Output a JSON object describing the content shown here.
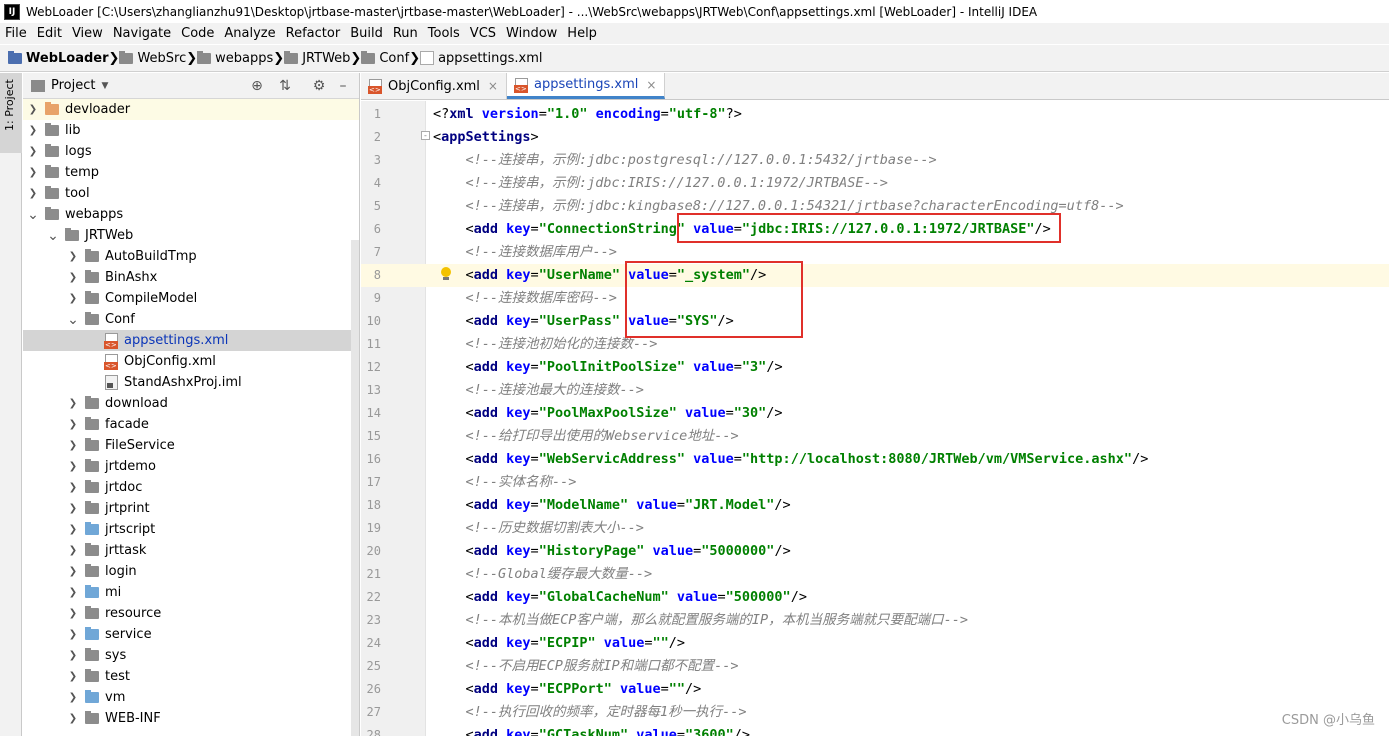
{
  "window": {
    "title": "WebLoader [C:\\Users\\zhanglianzhu91\\Desktop\\jrtbase-master\\jrtbase-master\\WebLoader] - ...\\WebSrc\\webapps\\JRTWeb\\Conf\\appsettings.xml [WebLoader] - IntelliJ IDEA",
    "app_icon": "IJ"
  },
  "menu": [
    "File",
    "Edit",
    "View",
    "Navigate",
    "Code",
    "Analyze",
    "Refactor",
    "Build",
    "Run",
    "Tools",
    "VCS",
    "Window",
    "Help"
  ],
  "breadcrumb": [
    "WebLoader",
    "WebSrc",
    "webapps",
    "JRTWeb",
    "Conf",
    "appsettings.xml"
  ],
  "side_strip": {
    "label": "1: Project"
  },
  "project_panel": {
    "title": "Project",
    "icons": [
      "crosshair-icon",
      "collapse-icon",
      "gear-icon",
      "minimize-icon"
    ],
    "tree": [
      {
        "label": "devloader",
        "depth": 2,
        "arrow": "right",
        "kind": "folder",
        "color": "orange",
        "highlight": true
      },
      {
        "label": "lib",
        "depth": 2,
        "arrow": "right",
        "kind": "folder",
        "color": "gray"
      },
      {
        "label": "logs",
        "depth": 2,
        "arrow": "right",
        "kind": "folder",
        "color": "gray"
      },
      {
        "label": "temp",
        "depth": 2,
        "arrow": "right",
        "kind": "folder",
        "color": "gray"
      },
      {
        "label": "tool",
        "depth": 2,
        "arrow": "right",
        "kind": "folder",
        "color": "gray"
      },
      {
        "label": "webapps",
        "depth": 2,
        "arrow": "down",
        "kind": "folder",
        "color": "gray"
      },
      {
        "label": "JRTWeb",
        "depth": 3,
        "arrow": "down",
        "kind": "folder",
        "color": "gray"
      },
      {
        "label": "AutoBuildTmp",
        "depth": 4,
        "arrow": "right",
        "kind": "folder",
        "color": "gray"
      },
      {
        "label": "BinAshx",
        "depth": 4,
        "arrow": "right",
        "kind": "folder",
        "color": "gray"
      },
      {
        "label": "CompileModel",
        "depth": 4,
        "arrow": "right",
        "kind": "folder",
        "color": "gray"
      },
      {
        "label": "Conf",
        "depth": 4,
        "arrow": "down",
        "kind": "folder",
        "color": "gray"
      },
      {
        "label": "appsettings.xml",
        "depth": 5,
        "arrow": "",
        "kind": "xml",
        "selected": true
      },
      {
        "label": "ObjConfig.xml",
        "depth": 5,
        "arrow": "",
        "kind": "xml"
      },
      {
        "label": "StandAshxProj.iml",
        "depth": 5,
        "arrow": "",
        "kind": "iml"
      },
      {
        "label": "download",
        "depth": 4,
        "arrow": "right",
        "kind": "folder",
        "color": "gray"
      },
      {
        "label": "facade",
        "depth": 4,
        "arrow": "right",
        "kind": "folder",
        "color": "gray"
      },
      {
        "label": "FileService",
        "depth": 4,
        "arrow": "right",
        "kind": "folder",
        "color": "gray"
      },
      {
        "label": "jrtdemo",
        "depth": 4,
        "arrow": "right",
        "kind": "folder",
        "color": "gray"
      },
      {
        "label": "jrtdoc",
        "depth": 4,
        "arrow": "right",
        "kind": "folder",
        "color": "gray"
      },
      {
        "label": "jrtprint",
        "depth": 4,
        "arrow": "right",
        "kind": "folder",
        "color": "gray"
      },
      {
        "label": "jrtscript",
        "depth": 4,
        "arrow": "right",
        "kind": "folder",
        "color": "blue"
      },
      {
        "label": "jrttask",
        "depth": 4,
        "arrow": "right",
        "kind": "folder",
        "color": "gray"
      },
      {
        "label": "login",
        "depth": 4,
        "arrow": "right",
        "kind": "folder",
        "color": "gray"
      },
      {
        "label": "mi",
        "depth": 4,
        "arrow": "right",
        "kind": "folder",
        "color": "blue"
      },
      {
        "label": "resource",
        "depth": 4,
        "arrow": "right",
        "kind": "folder",
        "color": "gray"
      },
      {
        "label": "service",
        "depth": 4,
        "arrow": "right",
        "kind": "folder",
        "color": "blue"
      },
      {
        "label": "sys",
        "depth": 4,
        "arrow": "right",
        "kind": "folder",
        "color": "gray"
      },
      {
        "label": "test",
        "depth": 4,
        "arrow": "right",
        "kind": "folder",
        "color": "gray"
      },
      {
        "label": "vm",
        "depth": 4,
        "arrow": "right",
        "kind": "folder",
        "color": "blue"
      },
      {
        "label": "WEB-INF",
        "depth": 4,
        "arrow": "right",
        "kind": "folder",
        "color": "gray"
      }
    ]
  },
  "tabs": [
    {
      "label": "ObjConfig.xml",
      "active": false
    },
    {
      "label": "appsettings.xml",
      "active": true
    }
  ],
  "editor": {
    "current_line": 8,
    "lines": [
      [
        [
          "punc",
          "<?"
        ],
        [
          "tag",
          "xml"
        ],
        [
          "attr",
          " version"
        ],
        [
          "punc",
          "="
        ],
        [
          "str",
          "\"1.0\""
        ],
        [
          "attr",
          " encoding"
        ],
        [
          "punc",
          "="
        ],
        [
          "str",
          "\"utf-8\""
        ],
        [
          "punc",
          "?>"
        ]
      ],
      [
        [
          "punc",
          "<"
        ],
        [
          "tag",
          "appSettings"
        ],
        [
          "punc",
          ">"
        ]
      ],
      [
        [
          "punc",
          "    "
        ],
        [
          "cmt",
          "<!--连接串，示例:jdbc:postgresql://127.0.0.1:5432/jrtbase-->"
        ]
      ],
      [
        [
          "punc",
          "    "
        ],
        [
          "cmt",
          "<!--连接串，示例:jdbc:IRIS://127.0.0.1:1972/JRTBASE-->"
        ]
      ],
      [
        [
          "punc",
          "    "
        ],
        [
          "cmt",
          "<!--连接串，示例:jdbc:kingbase8://127.0.0.1:54321/jrtbase?characterEncoding=utf8-->"
        ]
      ],
      [
        [
          "punc",
          "    <"
        ],
        [
          "tag",
          "add"
        ],
        [
          "attr",
          " key"
        ],
        [
          "punc",
          "="
        ],
        [
          "str",
          "\"ConnectionString\""
        ],
        [
          "attr",
          " value"
        ],
        [
          "punc",
          "="
        ],
        [
          "str",
          "\"jdbc:IRIS://127.0.0.1:1972/JRTBASE\""
        ],
        [
          "punc",
          "/>"
        ]
      ],
      [
        [
          "punc",
          "    "
        ],
        [
          "cmt",
          "<!--连接数据库用户-->"
        ]
      ],
      [
        [
          "punc",
          "    <"
        ],
        [
          "tag",
          "add"
        ],
        [
          "attr",
          " key"
        ],
        [
          "punc",
          "="
        ],
        [
          "str",
          "\"UserName\""
        ],
        [
          "attr",
          " value"
        ],
        [
          "punc",
          "="
        ],
        [
          "str",
          "\"_system\""
        ],
        [
          "punc",
          "/>"
        ]
      ],
      [
        [
          "punc",
          "    "
        ],
        [
          "cmt",
          "<!--连接数据库密码-->"
        ]
      ],
      [
        [
          "punc",
          "    <"
        ],
        [
          "tag",
          "add"
        ],
        [
          "attr",
          " key"
        ],
        [
          "punc",
          "="
        ],
        [
          "str",
          "\"UserPass\""
        ],
        [
          "attr",
          " value"
        ],
        [
          "punc",
          "="
        ],
        [
          "str",
          "\"SYS\""
        ],
        [
          "punc",
          "/>"
        ]
      ],
      [
        [
          "punc",
          "    "
        ],
        [
          "cmt",
          "<!--连接池初始化的连接数-->"
        ]
      ],
      [
        [
          "punc",
          "    <"
        ],
        [
          "tag",
          "add"
        ],
        [
          "attr",
          " key"
        ],
        [
          "punc",
          "="
        ],
        [
          "str",
          "\"PoolInitPoolSize\""
        ],
        [
          "attr",
          " value"
        ],
        [
          "punc",
          "="
        ],
        [
          "str",
          "\"3\""
        ],
        [
          "punc",
          "/>"
        ]
      ],
      [
        [
          "punc",
          "    "
        ],
        [
          "cmt",
          "<!--连接池最大的连接数-->"
        ]
      ],
      [
        [
          "punc",
          "    <"
        ],
        [
          "tag",
          "add"
        ],
        [
          "attr",
          " key"
        ],
        [
          "punc",
          "="
        ],
        [
          "str",
          "\"PoolMaxPoolSize\""
        ],
        [
          "attr",
          " value"
        ],
        [
          "punc",
          "="
        ],
        [
          "str",
          "\"30\""
        ],
        [
          "punc",
          "/>"
        ]
      ],
      [
        [
          "punc",
          "    "
        ],
        [
          "cmt",
          "<!--给打印导出使用的Webservice地址-->"
        ]
      ],
      [
        [
          "punc",
          "    <"
        ],
        [
          "tag",
          "add"
        ],
        [
          "attr",
          " key"
        ],
        [
          "punc",
          "="
        ],
        [
          "str",
          "\"WebServicAddress\""
        ],
        [
          "attr",
          " value"
        ],
        [
          "punc",
          "="
        ],
        [
          "str",
          "\"http://localhost:8080/JRTWeb/vm/VMService.ashx\""
        ],
        [
          "punc",
          "/>"
        ]
      ],
      [
        [
          "punc",
          "    "
        ],
        [
          "cmt",
          "<!--实体名称-->"
        ]
      ],
      [
        [
          "punc",
          "    <"
        ],
        [
          "tag",
          "add"
        ],
        [
          "attr",
          " key"
        ],
        [
          "punc",
          "="
        ],
        [
          "str",
          "\"ModelName\""
        ],
        [
          "attr",
          " value"
        ],
        [
          "punc",
          "="
        ],
        [
          "str",
          "\"JRT.Model\""
        ],
        [
          "punc",
          "/>"
        ]
      ],
      [
        [
          "punc",
          "    "
        ],
        [
          "cmt",
          "<!--历史数据切割表大小-->"
        ]
      ],
      [
        [
          "punc",
          "    <"
        ],
        [
          "tag",
          "add"
        ],
        [
          "attr",
          " key"
        ],
        [
          "punc",
          "="
        ],
        [
          "str",
          "\"HistoryPage\""
        ],
        [
          "attr",
          " value"
        ],
        [
          "punc",
          "="
        ],
        [
          "str",
          "\"5000000\""
        ],
        [
          "punc",
          "/>"
        ]
      ],
      [
        [
          "punc",
          "    "
        ],
        [
          "cmt",
          "<!--Global缓存最大数量-->"
        ]
      ],
      [
        [
          "punc",
          "    <"
        ],
        [
          "tag",
          "add"
        ],
        [
          "attr",
          " key"
        ],
        [
          "punc",
          "="
        ],
        [
          "str",
          "\"GlobalCacheNum\""
        ],
        [
          "attr",
          " value"
        ],
        [
          "punc",
          "="
        ],
        [
          "str",
          "\"500000\""
        ],
        [
          "punc",
          "/>"
        ]
      ],
      [
        [
          "punc",
          "    "
        ],
        [
          "cmt",
          "<!--本机当做ECP客户端，那么就配置服务端的IP，本机当服务端就只要配端口-->"
        ]
      ],
      [
        [
          "punc",
          "    <"
        ],
        [
          "tag",
          "add"
        ],
        [
          "attr",
          " key"
        ],
        [
          "punc",
          "="
        ],
        [
          "str",
          "\"ECPIP\""
        ],
        [
          "attr",
          " value"
        ],
        [
          "punc",
          "="
        ],
        [
          "str",
          "\"\""
        ],
        [
          "punc",
          "/>"
        ]
      ],
      [
        [
          "punc",
          "    "
        ],
        [
          "cmt",
          "<!--不启用ECP服务就IP和端口都不配置-->"
        ]
      ],
      [
        [
          "punc",
          "    <"
        ],
        [
          "tag",
          "add"
        ],
        [
          "attr",
          " key"
        ],
        [
          "punc",
          "="
        ],
        [
          "str",
          "\"ECPPort\""
        ],
        [
          "attr",
          " value"
        ],
        [
          "punc",
          "="
        ],
        [
          "str",
          "\"\""
        ],
        [
          "punc",
          "/>"
        ]
      ],
      [
        [
          "punc",
          "    "
        ],
        [
          "cmt",
          "<!--执行回收的频率，定时器每1秒一执行-->"
        ]
      ],
      [
        [
          "punc",
          "    <"
        ],
        [
          "tag",
          "add"
        ],
        [
          "attr",
          " key"
        ],
        [
          "punc",
          "="
        ],
        [
          "str",
          "\"GCTaskNum\""
        ],
        [
          "attr",
          " value"
        ],
        [
          "punc",
          "="
        ],
        [
          "str",
          "\"3600\""
        ],
        [
          "punc",
          "/>"
        ]
      ]
    ]
  },
  "watermark": "CSDN @小乌鱼"
}
